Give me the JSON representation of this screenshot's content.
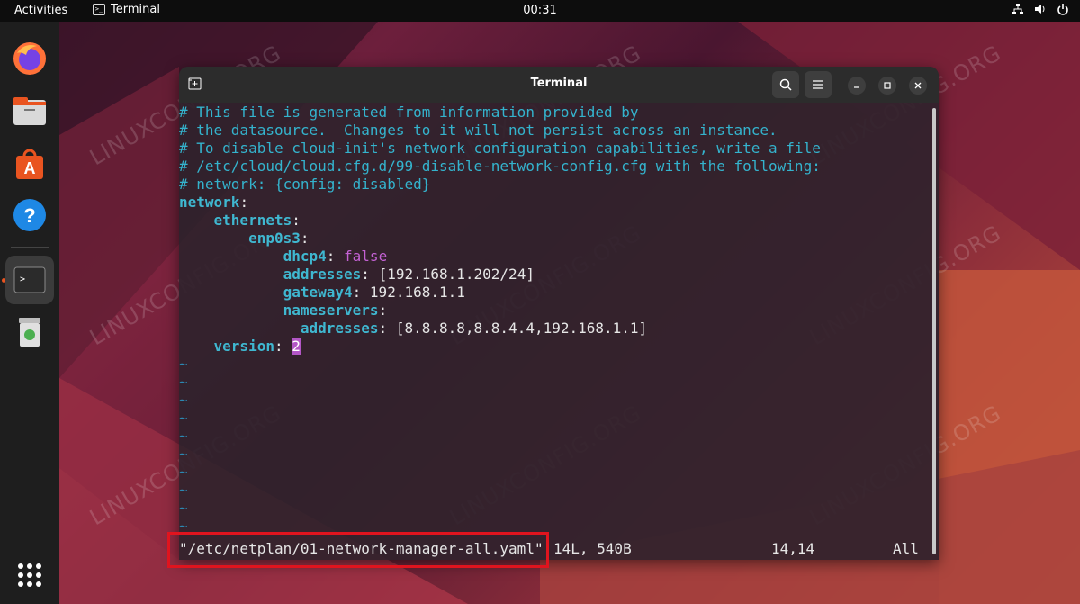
{
  "topbar": {
    "activities": "Activities",
    "app_name": "Terminal",
    "clock": "00:31"
  },
  "dock": {
    "items": [
      "firefox",
      "files",
      "app-center",
      "help",
      "terminal",
      "trash",
      "show-apps"
    ]
  },
  "window": {
    "title": "Terminal"
  },
  "editor": {
    "comments": [
      "# This file is generated from information provided by",
      "# the datasource.  Changes to it will not persist across an instance.",
      "# To disable cloud-init's network configuration capabilities, write a file",
      "# /etc/cloud/cloud.cfg.d/99-disable-network-config.cfg with the following:",
      "# network: {config: disabled}"
    ],
    "network_key": "network",
    "ethernets_key": "ethernets",
    "iface_key": "enp0s3",
    "dhcp4_key": "dhcp4",
    "dhcp4_value": "false",
    "addresses_key": "addresses",
    "addresses_value": "[192.168.1.202/24]",
    "gateway4_key": "gateway4",
    "gateway4_value": "192.168.1.1",
    "nameservers_key": "nameservers",
    "ns_addresses_key": "addresses",
    "ns_addresses_value": "[8.8.8.8,8.8.4.4,192.168.1.1]",
    "version_key": "version",
    "version_value": "2",
    "tilde": "~"
  },
  "statusline": {
    "filename": "\"/etc/netplan/01-network-manager-all.yaml\"",
    "fileinfo": "14L, 540B",
    "position": "14,14",
    "scroll": "All"
  },
  "watermark": "LINUXCONFIG.ORG",
  "colors": {
    "comment": "#34b3cd",
    "key": "#3fb7d0",
    "boolean": "#c361d3",
    "highlight_box": "#e0141e"
  }
}
